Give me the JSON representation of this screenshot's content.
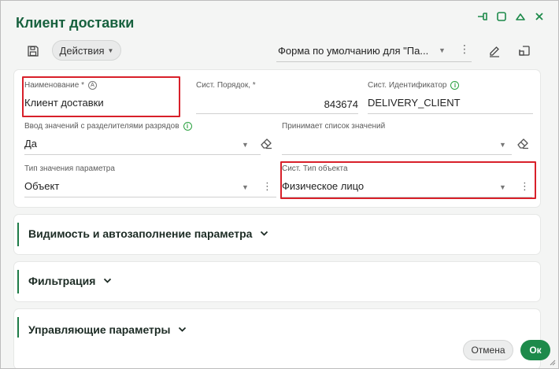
{
  "dialog": {
    "title": "Клиент доставки",
    "window_controls": [
      "dock-icon",
      "maximize-icon",
      "collapse-icon",
      "close-icon"
    ]
  },
  "toolbar": {
    "actions_label": "Действия",
    "form_select_value": "Форма по умолчанию для \"Па...",
    "icons": [
      "save-icon",
      "edit-form-icon",
      "open-window-icon"
    ]
  },
  "fields": {
    "name": {
      "label": "Наименование *",
      "value": "Клиент доставки"
    },
    "order": {
      "label": "Сист. Порядок, *",
      "value": "843674"
    },
    "identifier": {
      "label": "Сист. Идентификатор",
      "value": "DELIVERY_CLIENT"
    },
    "digit_separators": {
      "label": "Ввод значений с разделителями разрядов",
      "value": "Да"
    },
    "accepts_list": {
      "label": "Принимает список значений",
      "value": ""
    },
    "param_value_type": {
      "label": "Тип значения параметра",
      "value": "Объект"
    },
    "object_type": {
      "label": "Сист. Тип объекта",
      "value": "Физическое лицо"
    }
  },
  "sections": [
    {
      "title": "Видимость и автозаполнение параметра"
    },
    {
      "title": "Фильтрация"
    },
    {
      "title": "Управляющие параметры"
    }
  ],
  "footer": {
    "cancel_label": "Отмена",
    "ok_label": "Ок"
  },
  "colors": {
    "accent": "#1d8a4a",
    "title": "#17613e",
    "highlight": "#d8202a",
    "info": "#2aa140"
  }
}
